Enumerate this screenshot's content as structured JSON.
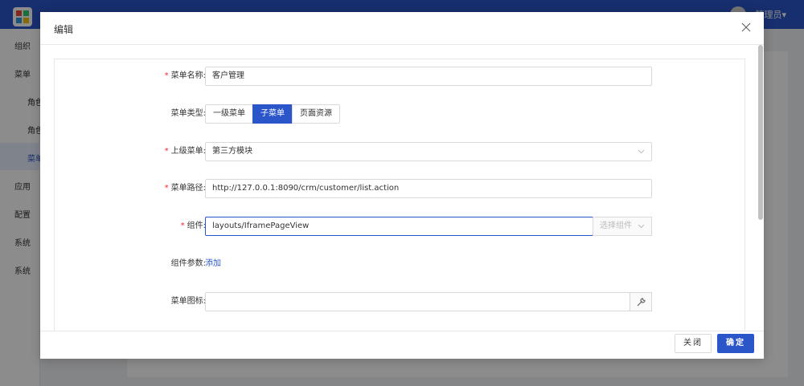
{
  "app": {
    "user": "管理员▾"
  },
  "sidebar": {
    "items": [
      {
        "label": "组织"
      },
      {
        "label": "菜单"
      },
      {
        "label": "角色"
      },
      {
        "label": "角色"
      },
      {
        "label": "菜单"
      },
      {
        "label": "应用"
      },
      {
        "label": "配置"
      },
      {
        "label": "系统"
      },
      {
        "label": "系统"
      }
    ]
  },
  "modal": {
    "title": "编辑",
    "fields": {
      "menu_name": {
        "label": "菜单名称:",
        "value": "客户管理"
      },
      "menu_type": {
        "label": "菜单类型:",
        "options": [
          "一级菜单",
          "子菜单",
          "页面资源"
        ],
        "selected": "子菜单"
      },
      "parent_menu": {
        "label": "上级菜单:",
        "value": "第三方模块"
      },
      "menu_path": {
        "label": "菜单路径:",
        "value": "http://127.0.0.1:8090/crm/customer/list.action"
      },
      "component": {
        "label": "组件:",
        "value": "layouts/IframePageView",
        "select_label": "选择组件"
      },
      "component_params": {
        "label": "组件参数:",
        "add_link": "添加"
      },
      "menu_icon": {
        "label": "菜单图标:",
        "value": ""
      }
    },
    "footer": {
      "close_label": "关闭",
      "confirm_label": "确定"
    }
  },
  "colors": {
    "primary": "#2b56c9",
    "required": "#f5222d"
  }
}
